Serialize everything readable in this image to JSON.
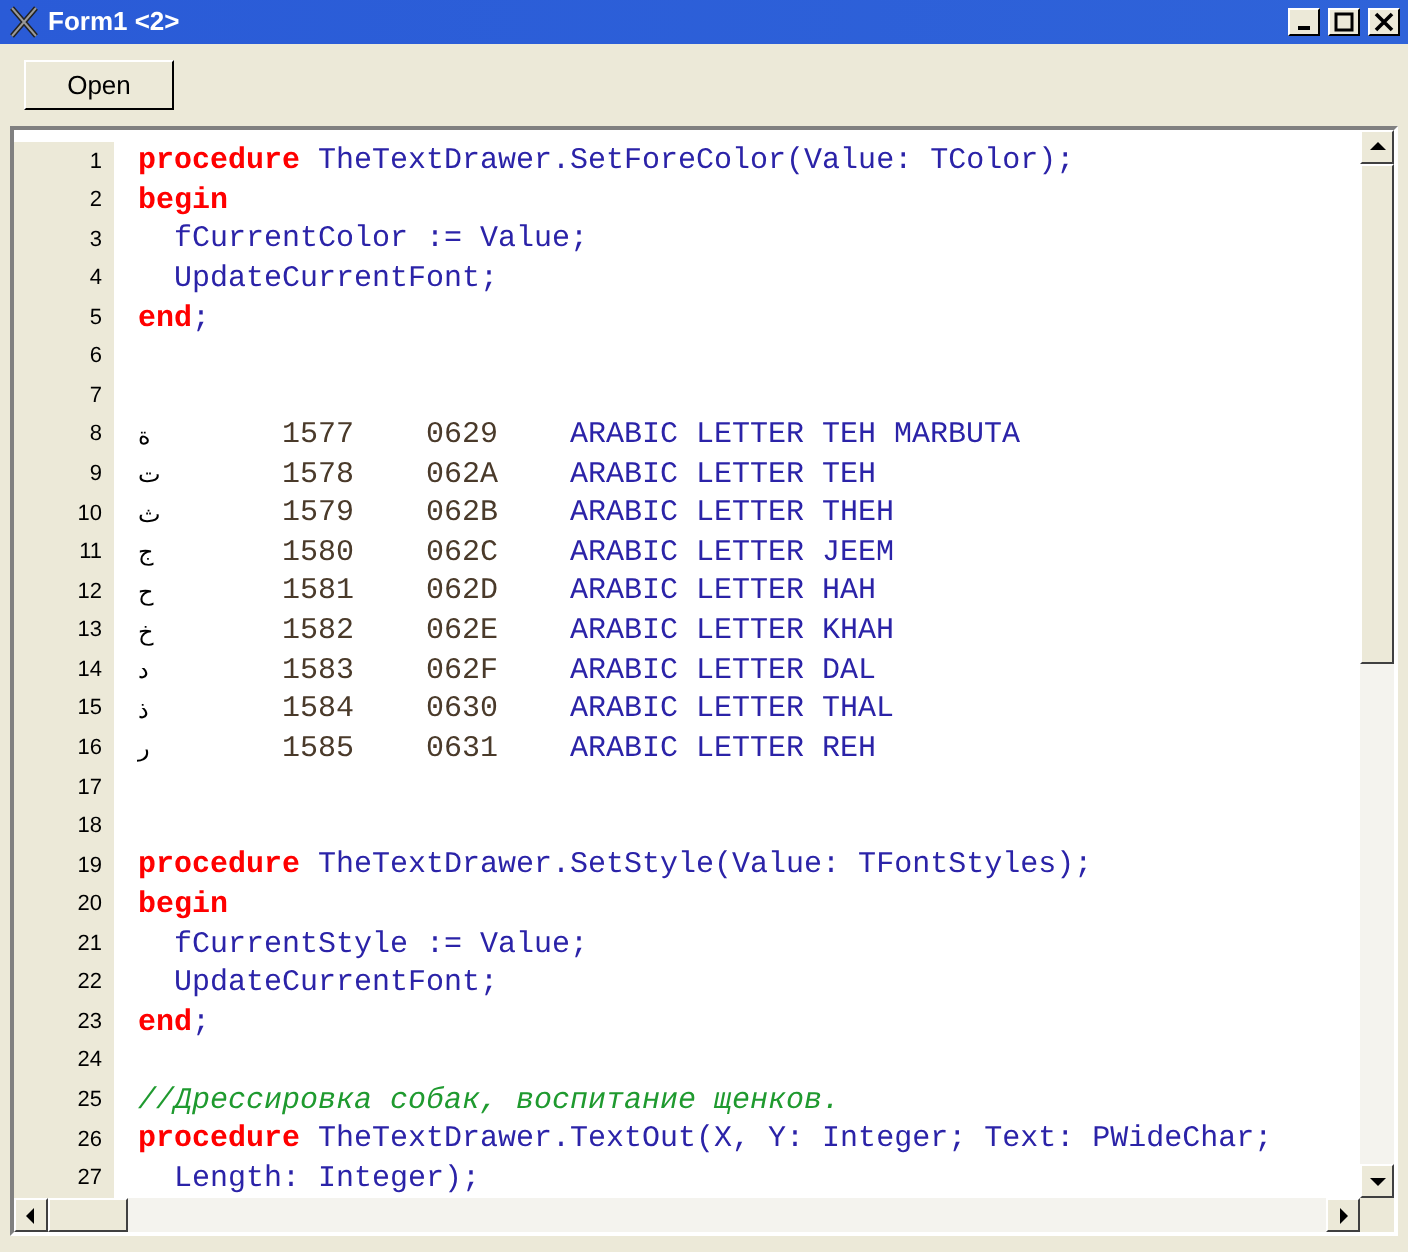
{
  "window": {
    "title": "Form1 <2>"
  },
  "toolbar": {
    "buttons": [
      "Open"
    ]
  },
  "editor": {
    "lines": [
      {
        "number": "1",
        "kind": "code",
        "tokens": [
          {
            "t": "procedure",
            "kind": "keyword"
          },
          {
            "t": " TheTextDrawer.SetForeColor(Value: TColor);",
            "kind": "identifier"
          }
        ]
      },
      {
        "number": "2",
        "kind": "code",
        "tokens": [
          {
            "t": "begin",
            "kind": "keyword"
          }
        ]
      },
      {
        "number": "3",
        "kind": "code",
        "tokens": [
          {
            "t": "  fCurrentColor := Value;",
            "kind": "identifier"
          }
        ]
      },
      {
        "number": "4",
        "kind": "code",
        "tokens": [
          {
            "t": "  UpdateCurrentFont;",
            "kind": "identifier"
          }
        ]
      },
      {
        "number": "5",
        "kind": "code",
        "tokens": [
          {
            "t": "end",
            "kind": "keyword"
          },
          {
            "t": ";",
            "kind": "identifier"
          }
        ]
      },
      {
        "number": "6",
        "kind": "code"
      },
      {
        "number": "7",
        "kind": "code"
      },
      {
        "number": "8",
        "kind": "table",
        "cells": [
          "ة",
          "1577",
          "0629",
          "ARABIC LETTER TEH MARBUTA"
        ]
      },
      {
        "number": "9",
        "kind": "table",
        "cells": [
          "ت",
          "1578",
          "062A",
          "ARABIC LETTER TEH"
        ]
      },
      {
        "number": "10",
        "kind": "table",
        "cells": [
          "ث",
          "1579",
          "062B",
          "ARABIC LETTER THEH"
        ]
      },
      {
        "number": "11",
        "kind": "table",
        "cells": [
          "ج",
          "1580",
          "062C",
          "ARABIC LETTER JEEM"
        ]
      },
      {
        "number": "12",
        "kind": "table",
        "cells": [
          "ح",
          "1581",
          "062D",
          "ARABIC LETTER HAH"
        ]
      },
      {
        "number": "13",
        "kind": "table",
        "cells": [
          "خ",
          "1582",
          "062E",
          "ARABIC LETTER KHAH"
        ]
      },
      {
        "number": "14",
        "kind": "table",
        "cells": [
          "د",
          "1583",
          "062F",
          "ARABIC LETTER DAL"
        ]
      },
      {
        "number": "15",
        "kind": "table",
        "cells": [
          "ذ",
          "1584",
          "0630",
          "ARABIC LETTER THAL"
        ]
      },
      {
        "number": "16",
        "kind": "table",
        "cells": [
          "ر",
          "1585",
          "0631",
          "ARABIC LETTER REH"
        ]
      },
      {
        "number": "17",
        "kind": "code"
      },
      {
        "number": "18",
        "kind": "code"
      },
      {
        "number": "19",
        "kind": "code",
        "tokens": [
          {
            "t": "procedure",
            "kind": "keyword"
          },
          {
            "t": " TheTextDrawer.SetStyle(Value: TFontStyles);",
            "kind": "identifier"
          }
        ]
      },
      {
        "number": "20",
        "kind": "code",
        "tokens": [
          {
            "t": "begin",
            "kind": "keyword"
          }
        ]
      },
      {
        "number": "21",
        "kind": "code",
        "tokens": [
          {
            "t": "  fCurrentStyle := Value;",
            "kind": "identifier"
          }
        ]
      },
      {
        "number": "22",
        "kind": "code",
        "tokens": [
          {
            "t": "  UpdateCurrentFont;",
            "kind": "identifier"
          }
        ]
      },
      {
        "number": "23",
        "kind": "code",
        "tokens": [
          {
            "t": "end",
            "kind": "keyword"
          },
          {
            "t": ";",
            "kind": "identifier"
          }
        ]
      },
      {
        "number": "24",
        "kind": "code"
      },
      {
        "number": "25",
        "kind": "code",
        "tokens": [
          {
            "t": "//Дрессировка собак, воспитание щенков.",
            "kind": "comment"
          }
        ]
      },
      {
        "number": "26",
        "kind": "code",
        "tokens": [
          {
            "t": "procedure",
            "kind": "keyword"
          },
          {
            "t": " TheTextDrawer.TextOut(X, Y: Integer; Text: PWideChar;",
            "kind": "identifier"
          }
        ]
      },
      {
        "number": "27",
        "kind": "code",
        "tokens": [
          {
            "t": "  Length: Integer);",
            "kind": "identifier"
          }
        ]
      }
    ]
  }
}
